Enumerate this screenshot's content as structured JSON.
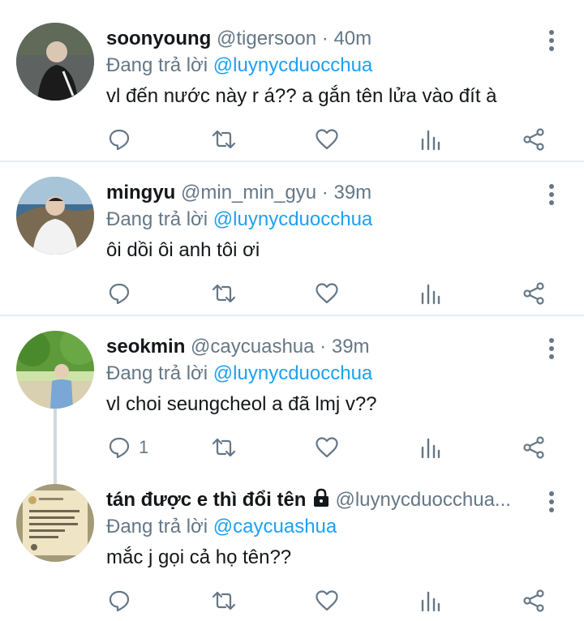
{
  "tweets": [
    {
      "name": "soonyoung",
      "handle": "@tigersoon",
      "dot": "·",
      "time": "40m",
      "reply_prefix": "Đang trả lời",
      "reply_to": "@luynycduocchua",
      "text": "vl đến nước này r á??  a gắn tên lửa vào đít à",
      "reply_count": "",
      "avatar": "person-in-black-jacket-on-road"
    },
    {
      "name": "mingyu",
      "handle": "@min_min_gyu",
      "dot": "·",
      "time": "39m",
      "reply_prefix": "Đang trả lời",
      "reply_to": "@luynycduocchua",
      "text": "ôi dồi ôi anh tôi ơi",
      "reply_count": "",
      "avatar": "person-in-white-shirt-seaside"
    },
    {
      "name": "seokmin",
      "handle": "@caycuashua",
      "dot": "·",
      "time": "39m",
      "reply_prefix": "Đang trả lời",
      "reply_to": "@luynycduocchua",
      "text": "vl choi seungcheol a đã lmj v??",
      "reply_count": "1",
      "avatar": "person-in-park-with-trees"
    },
    {
      "name": "tán được e thì đổi tên",
      "handle": "@luynycduocchua...",
      "dot": "",
      "time": "",
      "reply_prefix": "Đang trả lời",
      "reply_to": "@caycuashua",
      "text": "mắc j gọi cả họ tên??",
      "reply_count": "",
      "avatar": "screenshot-of-note",
      "protected": true
    }
  ],
  "icons": {
    "reply": "reply-icon",
    "retweet": "retweet-icon",
    "like": "heart-icon",
    "analytics": "analytics-icon",
    "share": "share-icon",
    "more": "more-vertical-icon",
    "lock": "lock-icon"
  },
  "colors": {
    "text": "#14171a",
    "secondary": "#657786",
    "link": "#1da1f2",
    "divider": "#e6ecf0"
  }
}
